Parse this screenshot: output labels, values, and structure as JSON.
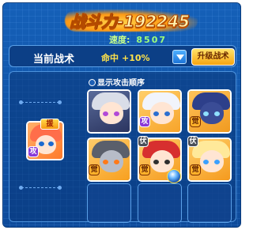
{
  "header": {
    "power_text": "战斗力-192245",
    "speed_label": "速度:",
    "speed_value": "8507"
  },
  "tactic": {
    "title": "当前战术",
    "hit_label": "命中",
    "hit_value": "+10%",
    "upgrade_label": "升级战术"
  },
  "formation": {
    "show_order_label": "显示攻击顺序",
    "assist_label": "援",
    "badges": {
      "purple": "攻",
      "orange": "觉",
      "guard": "伏"
    }
  },
  "colors": {
    "frame_blue": "#1560b8",
    "power_orange": "#ff9a14",
    "speed_green": "#9eff7a",
    "hit_yellow": "#ffe24a",
    "upgrade_gold": "#f7a410"
  }
}
